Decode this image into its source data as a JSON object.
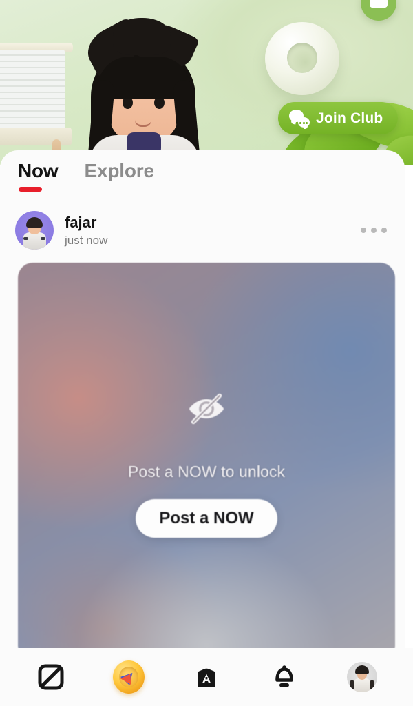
{
  "hero": {
    "background_color": "#d8e9c6",
    "join_club": {
      "label": "Join Club",
      "icon": "wechat-bubbles-icon",
      "color": "#74b225"
    },
    "minimize_button": {
      "icon": "minimize-icon",
      "color": "#8bbf54"
    },
    "character": {
      "icon": "avatar-character-3d"
    },
    "decor": {
      "donut": "donut-ring-decor",
      "plant": "plant-leaves-decor"
    }
  },
  "sheet": {
    "tabs": [
      {
        "label": "Now",
        "active": true
      },
      {
        "label": "Explore",
        "active": false
      }
    ],
    "active_indicator_color": "#e81f2b",
    "post": {
      "username": "fajar",
      "timestamp": "just now",
      "avatar_icon": "user-avatar-icon",
      "more_icon": "more-horizontal-icon",
      "locked": {
        "icon": "eye-slash-icon",
        "message": "Post a NOW to unlock",
        "button_label": "Post a NOW"
      }
    }
  },
  "bottom_nav": {
    "items": [
      {
        "name": "moments",
        "icon": "moments-icon"
      },
      {
        "name": "coin",
        "icon": "coin-arrow-icon"
      },
      {
        "name": "shop",
        "icon": "shop-home-icon"
      },
      {
        "name": "notifications",
        "icon": "bell-icon"
      },
      {
        "name": "profile",
        "icon": "profile-avatar-icon"
      }
    ]
  }
}
